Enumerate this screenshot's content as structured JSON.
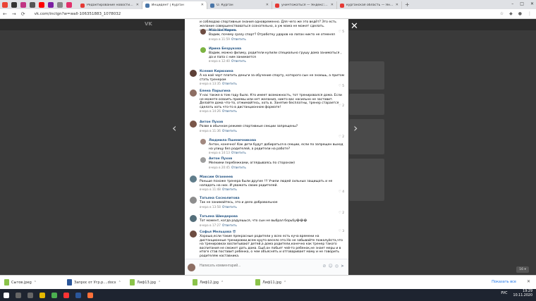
{
  "browser": {
    "tabs": [
      {
        "title": "Редактирование новости № 9...",
        "color": "#e53935"
      },
      {
        "title": "Инцидент | Курган",
        "color": "#4a76a8"
      },
      {
        "title": "О. Курган",
        "color": "#4a76a8"
      },
      {
        "title": "уничтожаться — Яндекс: нашл...",
        "color": "#e53935"
      },
      {
        "title": "курганская область — Яндекс: нашл...",
        "color": "#e53935"
      }
    ],
    "url": "vk.com/inctgn?w=wall-106351883_1078032",
    "new_tab": "+"
  },
  "vk": {
    "logo": "VK",
    "close": "✕",
    "prev": "‹",
    "next": "›"
  },
  "comments": [
    {
      "name": "",
      "text": "и соблюдаю спортивные знания одновременно. Для чего же это ведёт? Это есть желание совершенствоваться сознательно, а уж мама не может сделать.",
      "meta": "вчера в 11:35",
      "reply": "Ответить",
      "likes": "5",
      "reply_level": 0
    },
    {
      "name": "Максим Карев",
      "text": "Вадим, почему сразу спорт? Отработку ударов на лапах никто не отменял",
      "meta": "вчера в 11:59",
      "reply": "Ответить",
      "likes": "",
      "reply_level": 1
    },
    {
      "name": "Ирина Безрукова",
      "text": "Вадим, можно физику, родители купили специально грушу дома заниматься , да и папа с ним занимается",
      "meta": "вчера в 12:40",
      "reply": "Ответить",
      "likes": "",
      "reply_level": 1
    },
    {
      "name": "Ксения Кирюхина",
      "text": "А на кой черт платить деньги за обучение спорту, которого сын не знаешь, а притом стать тренером",
      "meta": "вчера в 13:35",
      "reply": "Ответить",
      "likes": "5",
      "reply_level": 0
    },
    {
      "name": "Елена Парыгина",
      "text": "У нас также в том году было. Кто имеет возможность, тот тренировался дома. Если не можете освоить приемы или нет желания, никто вас насильно не заставит. Делайте дома что-то, отжимайтесь, хоть в. Занятие бесплатны, тренер старается сделать хоть что-то в дистанционном формате!",
      "meta": "вчера в 14:26",
      "reply": "Ответить",
      "likes": "2",
      "reply_level": 0
    },
    {
      "name": "Антон Пухов",
      "text": "Разве в обычном режиме спортивные секции запрещены?",
      "meta": "вчера в 11:36",
      "reply": "Ответить",
      "likes": "2",
      "reply_level": 0
    },
    {
      "name": "Людмила Пшеничникова",
      "text": "Антон, конечно! Как дети будут добираться в секции, если по запрещен выход на улицу без родителей, а родители на работе?",
      "meta": "вчера в 14:13",
      "reply": "Ответить",
      "likes": "",
      "reply_level": 1
    },
    {
      "name": "Антон Пухов",
      "text": "Мелкими перебежками, оглядываясь по сторонам)",
      "meta": "вчера в 20:45",
      "reply": "Ответить",
      "likes": "",
      "reply_level": 1
    },
    {
      "name": "Максим Оганнеев",
      "text": "Раньше похоже тренера были другие !!! Учили людей сильных защищать и не нападать на них. И уважать своих родителей.",
      "meta": "вчера в 11:48",
      "reply": "Ответить",
      "likes": "4",
      "reply_level": 0
    },
    {
      "name": "Татьяна Соснолитова",
      "text": "Так не занимайтесь, это и дело добровольное",
      "meta": "вчера в 13:58",
      "reply": "Ответить",
      "likes": "2",
      "reply_level": 0
    },
    {
      "name": "Татьяна Шиндерова",
      "text": "Тот момент, когда радуешься, что сын не выбрал борьбу😂😂😂",
      "meta": "вчера в 17:27",
      "reply": "Ответить",
      "likes": "3",
      "reply_level": 0
    },
    {
      "name": "Софья Мельцова 😎",
      "text": "Хорошо,если такие прекрасные родители у всех есть куча времени на дистанционные тренировки,всем круто весело это.Но не забывайте пожалуйста,что на тренировках воспитывают детей,а дома родители,конечно как тренер такого воспитания не сможет дать дома. Ещё,он побьет чей-то ребенок,не знает меры и в итоге став поставит ребенка, о чем объяснять и отговаривает маму и не говорить родителям наставника.",
      "meta": "",
      "reply": "",
      "likes": "",
      "reply_level": 0
    }
  ],
  "input": {
    "placeholder": "Написать комментарий..."
  },
  "side_badge": "16 ▾",
  "downloads": {
    "items": [
      {
        "name": "Сытов.jpeg",
        "color": "#8bc34a"
      },
      {
        "name": "Запрос от Угр.р....docx",
        "color": "#2b579a"
      },
      {
        "name": "Лиф13.jpg",
        "color": "#8bc34a"
      },
      {
        "name": "Лиф12.jpg",
        "color": "#8bc34a"
      },
      {
        "name": "Лиф11.jpg",
        "color": "#8bc34a"
      }
    ],
    "show_all": "Показать все",
    "close": "✕"
  },
  "taskbar": {
    "time": "19:29",
    "date": "10.11.2020",
    "lang": "РУС"
  }
}
